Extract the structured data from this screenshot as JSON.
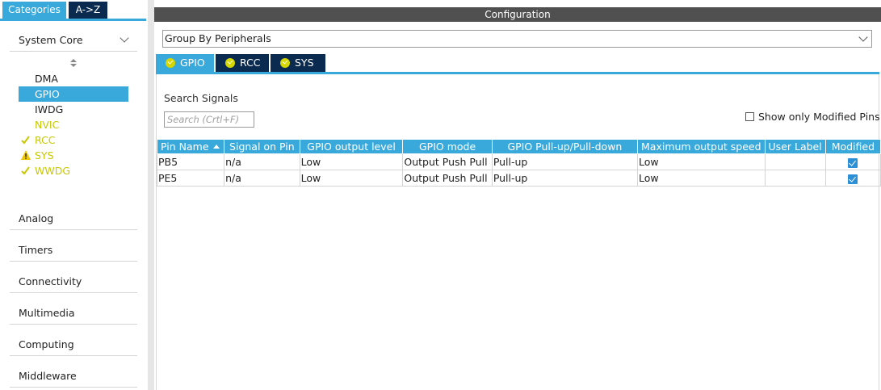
{
  "left_tabs": {
    "categories": "Categories",
    "az": "A->Z"
  },
  "system_core": {
    "label": "System Core",
    "items": [
      {
        "label": "DMA",
        "status": "none"
      },
      {
        "label": "GPIO",
        "status": "selected"
      },
      {
        "label": "IWDG",
        "status": "none"
      },
      {
        "label": "NVIC",
        "status": "none"
      },
      {
        "label": "RCC",
        "status": "ok"
      },
      {
        "label": "SYS",
        "status": "warning"
      },
      {
        "label": "WWDG",
        "status": "ok"
      }
    ]
  },
  "categories": [
    {
      "label": "Analog"
    },
    {
      "label": "Timers"
    },
    {
      "label": "Connectivity"
    },
    {
      "label": "Multimedia"
    },
    {
      "label": "Computing"
    },
    {
      "label": "Middleware"
    }
  ],
  "config": {
    "title": "Configuration",
    "group_by": "Group By Peripherals",
    "tabs": [
      {
        "label": "GPIO"
      },
      {
        "label": "RCC"
      },
      {
        "label": "SYS"
      }
    ],
    "search_label": "Search Signals",
    "search_placeholder": "Search (Crtl+F)",
    "show_modified": "Show only Modified Pins"
  },
  "table": {
    "headers": [
      "Pin Name",
      "Signal on Pin",
      "GPIO output level",
      "GPIO mode",
      "GPIO Pull-up/Pull-down",
      "Maximum output speed",
      "User Label",
      "Modified"
    ],
    "rows": [
      [
        "PB5",
        "n/a",
        "Low",
        "Output Push Pull",
        "Pull-up",
        "Low",
        "",
        "checked"
      ],
      [
        "PE5",
        "n/a",
        "Low",
        "Output Push Pull",
        "Pull-up",
        "Low",
        "",
        "checked"
      ]
    ]
  },
  "colors": {
    "accent": "#39a9dc",
    "navy": "#0b2a4f",
    "yellow": "#c8c800",
    "bar": "#505050"
  }
}
